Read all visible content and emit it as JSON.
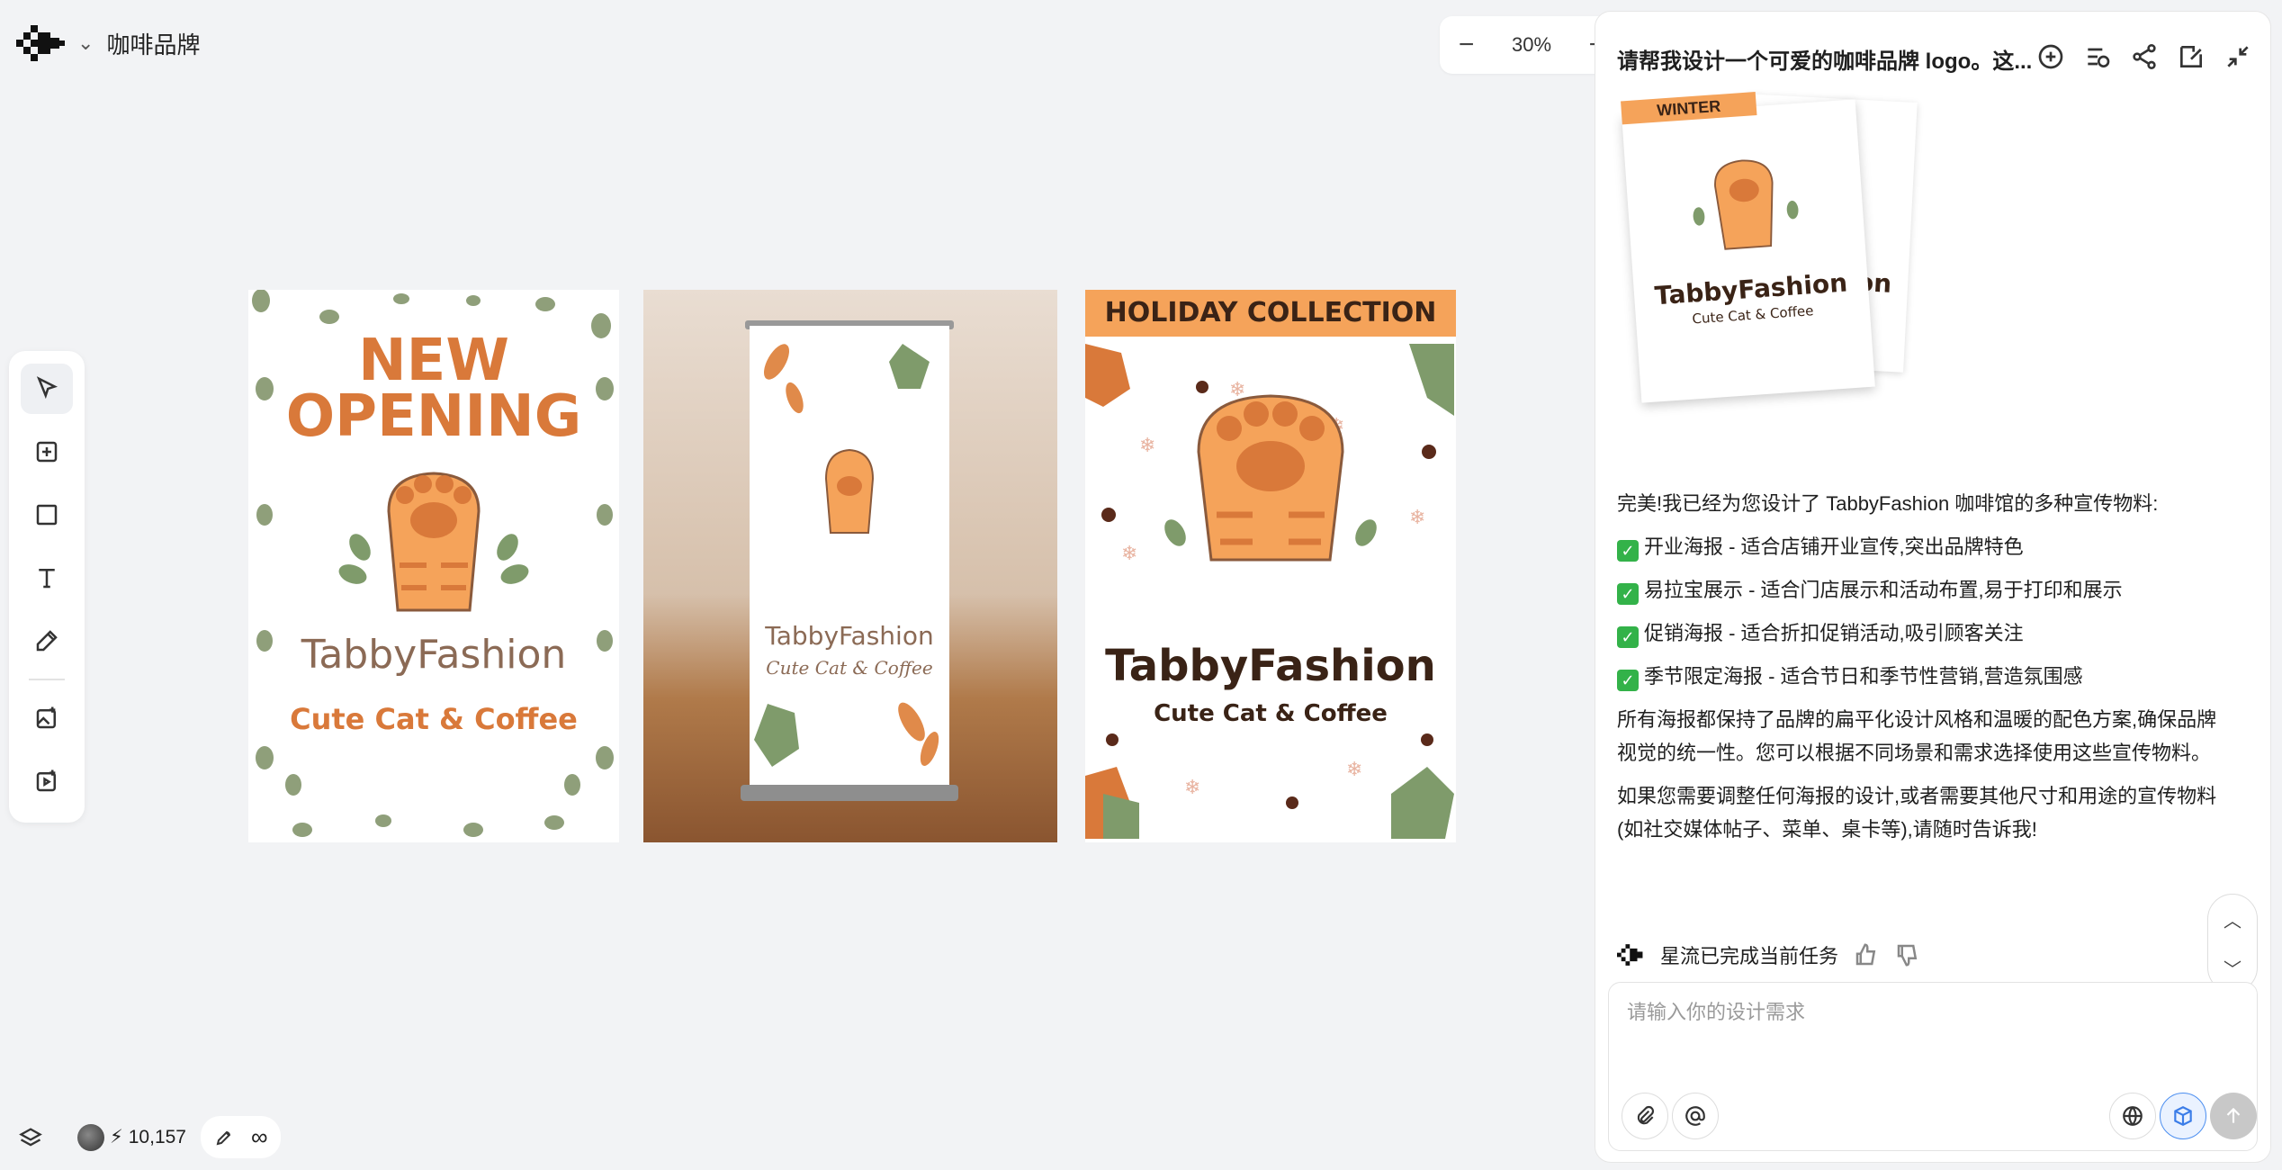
{
  "app": {
    "project_title": "咖啡品牌"
  },
  "zoom": {
    "minus": "−",
    "level": "30%",
    "plus": "+"
  },
  "toolbar": {
    "items": [
      {
        "name": "select",
        "icon": "cursor-icon"
      },
      {
        "name": "add-frame",
        "icon": "plus-square-icon"
      },
      {
        "name": "rectangle",
        "icon": "square-icon"
      },
      {
        "name": "text",
        "icon": "text-icon"
      },
      {
        "name": "pen",
        "icon": "pen-icon"
      },
      {
        "name": "image-gen",
        "icon": "image-sparkle-icon"
      },
      {
        "name": "video-gen",
        "icon": "video-sparkle-icon"
      }
    ]
  },
  "canvas": {
    "poster1": {
      "line1": "NEW",
      "line2": "OPENING",
      "brand": "TabbyFashion",
      "tagline": "Cute Cat & Coffee"
    },
    "poster2": {
      "brand": "TabbyFashion",
      "tagline": "Cute Cat & Coffee"
    },
    "poster3": {
      "banner": "HOLIDAY COLLECTION",
      "brand": "TabbyFashion",
      "tagline": "Cute Cat & Coffee"
    }
  },
  "chat": {
    "title": "请帮我设计一个可爱的咖啡品牌 logo。这...",
    "thumb": {
      "banner": "WINTER",
      "brand": "TabbyFashion",
      "tagline": "Cute Cat & Coffee",
      "back_partial": "on"
    },
    "intro": "完美!我已经为您设计了 TabbyFashion 咖啡馆的多种宣传物料:",
    "items": [
      "开业海报 - 适合店铺开业宣传,突出品牌特色",
      "易拉宝展示 - 适合门店展示和活动布置,易于打印和展示",
      "促销海报 - 适合折扣促销活动,吸引顾客关注",
      "季节限定海报 - 适合节日和季节性营销,营造氛围感"
    ],
    "check_glyph": "✓",
    "para1": "所有海报都保持了品牌的扁平化设计风格和温暖的配色方案,确保品牌视觉的统一性。您可以根据不同场景和需求选择使用这些宣传物料。",
    "para2": "如果您需要调整任何海报的设计,或者需要其他尺寸和用途的宣传物料(如社交媒体帖子、菜单、桌卡等),请随时告诉我!",
    "status": "星流已完成当前任务",
    "input_placeholder": "请输入你的设计需求"
  },
  "bottom": {
    "credits": "10,157",
    "bolt": "⚡",
    "infinity": "∞"
  }
}
